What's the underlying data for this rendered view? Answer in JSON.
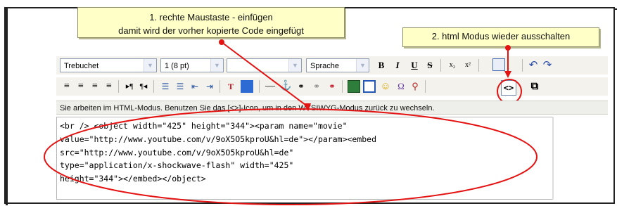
{
  "callouts": {
    "step1_line1": "1. rechte Maustaste - einfügen",
    "step1_line2": "damit wird der vorher kopierte Code eingefügt",
    "step2": "2. html Modus wieder ausschalten"
  },
  "toolbar": {
    "font_family": "Trebuchet",
    "font_size": "1 (8 pt)",
    "format": "",
    "language": "Sprache",
    "bold_label": "B",
    "italic_label": "I",
    "underline_label": "U",
    "strike_label": "S",
    "html_mode_label": "<>"
  },
  "status": {
    "message": "Sie arbeiten im HTML-Modus. Benutzen Sie das [<>]-Icon, um in den WYSIWYG-Modus zurück zu wechseln."
  },
  "editor": {
    "code": "<br /> <object width=\"425\" height=\"344\"><param name=\"movie\"\nvalue=\"http://www.youtube.com/v/9oX5O5kproU&hl=de\"></param><embed\nsrc=\"http://www.youtube.com/v/9oX5O5kproU&hl=de\"\ntype=\"application/x-shockwave-flash\" width=\"425\"\nheight=\"344\"></embed></object>"
  },
  "colors": {
    "annotation_red": "#e51212",
    "callout_bg": "#ffffc8",
    "toolbar_bg": "#f3f2ec"
  }
}
